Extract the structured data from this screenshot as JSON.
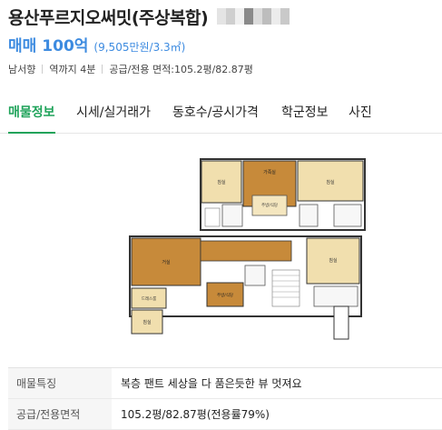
{
  "listing": {
    "title": "용산푸르지오써밋(주상복합)",
    "deal_type": "매매",
    "price": "100억",
    "price_detail": "(9,505만원/3.3㎡)",
    "info": [
      "남서향",
      "역까지 4분",
      "공급/전용 면적:105.2평/82.87평"
    ]
  },
  "tabs": [
    "매물정보",
    "시세/실거래가",
    "동호수/공시가격",
    "학군정보",
    "사진"
  ],
  "floorplan": {
    "upper": {
      "bed_left": "침실",
      "family": "가족실",
      "kitchen": "주방/식당",
      "bed_right": "침실"
    },
    "lower": {
      "living": "거실",
      "kitchen": "주방/식당",
      "dress": "드레스룸",
      "bed_left": "침실",
      "bed_right": "침실"
    }
  },
  "details": [
    {
      "key": "매물특징",
      "value": "복층 팬트 세상을 다 품은듯한 뷰 멋져요"
    },
    {
      "key": "공급/전용면적",
      "value": "105.2평/82.87평(전용률79%)"
    }
  ]
}
